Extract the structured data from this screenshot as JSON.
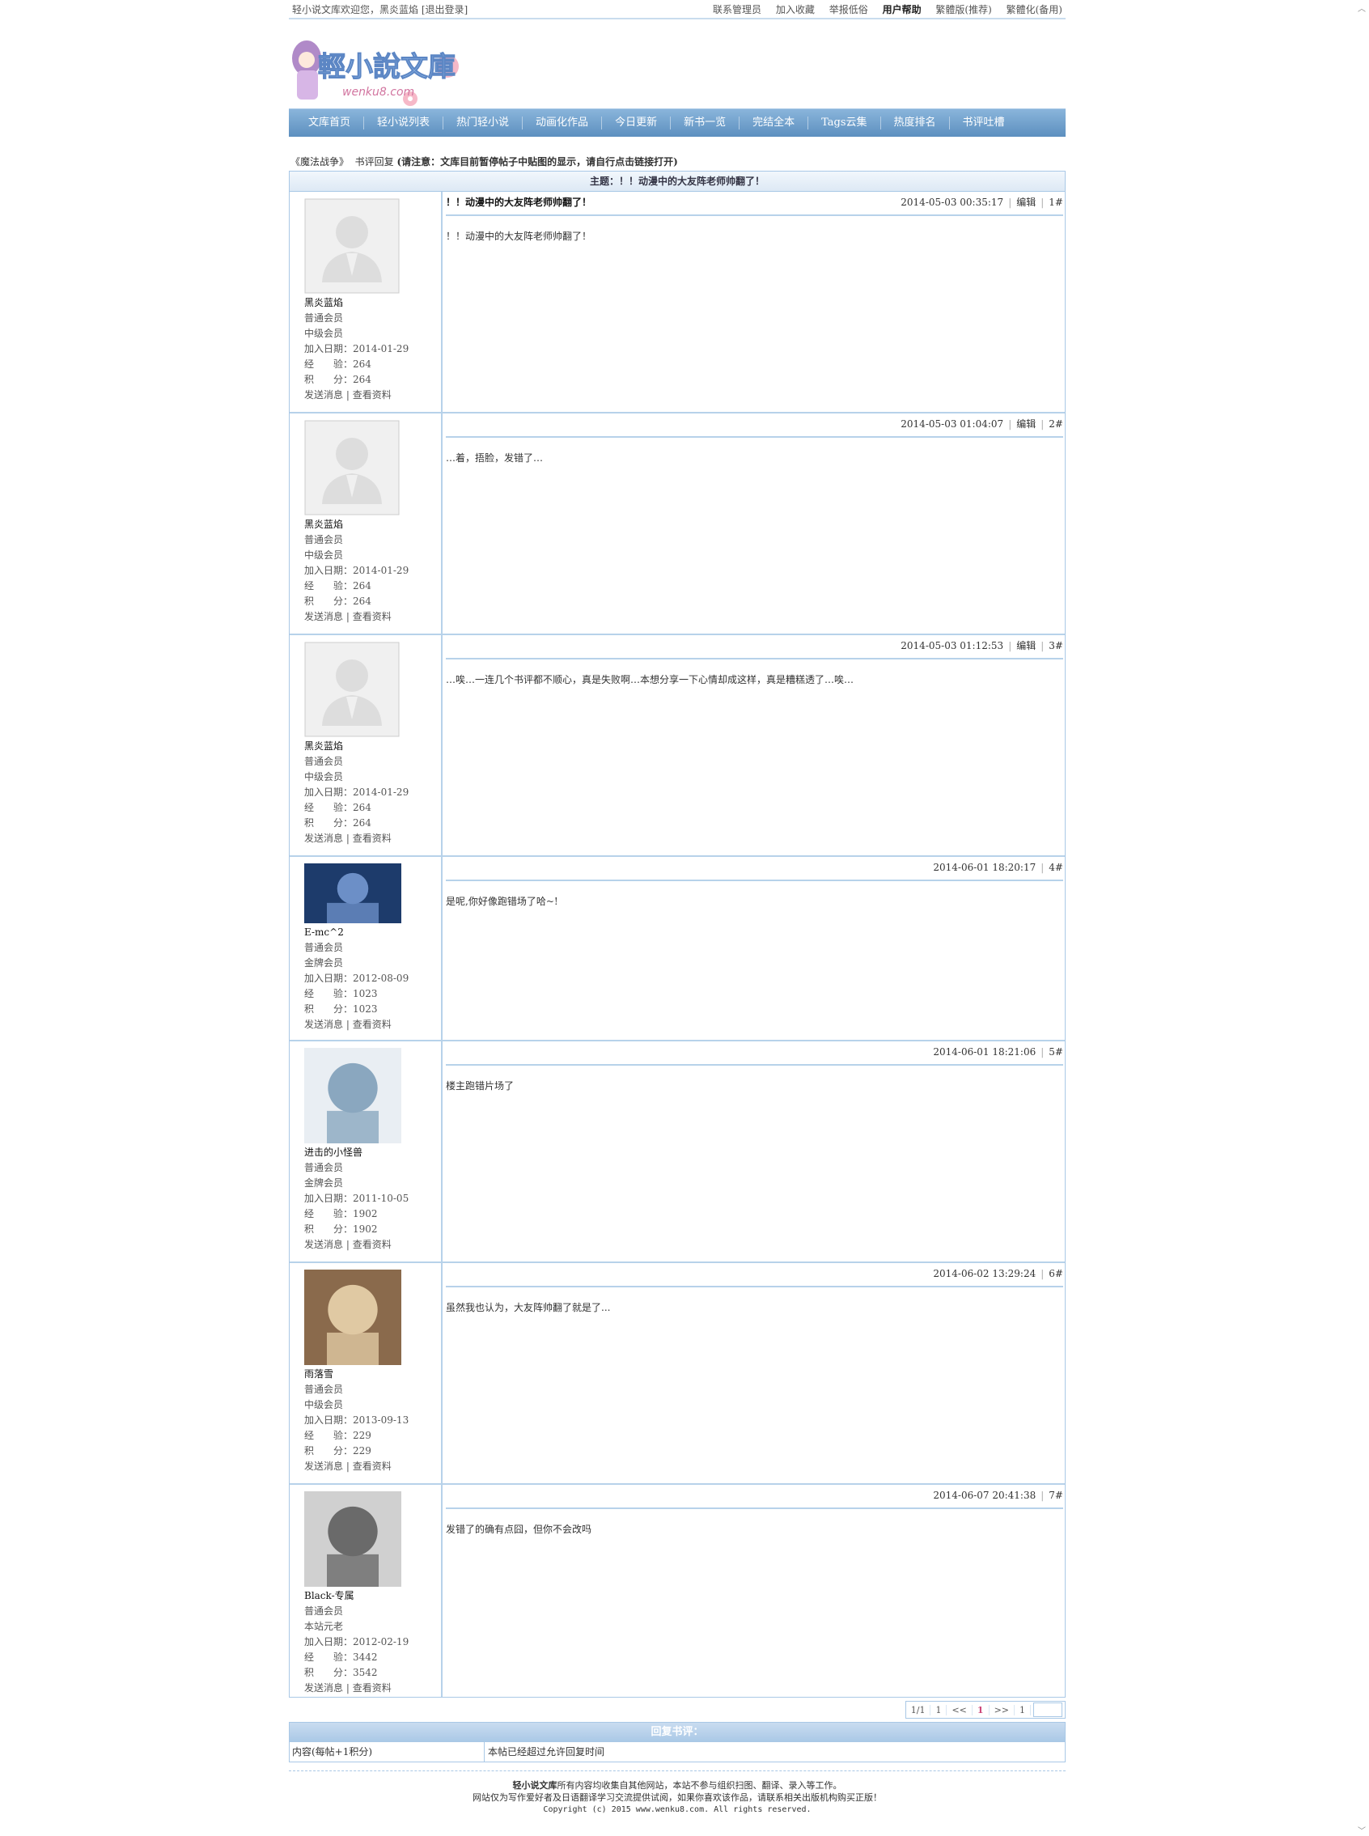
{
  "topbar": {
    "welcome": "轻小说文库欢迎您，黑炎蓝焰 [退出登录]",
    "links": [
      "联系管理员",
      "加入收藏",
      "举报低俗",
      "用户帮助",
      "繁體版(推荐)",
      "繁體化(备用)"
    ]
  },
  "logo": {
    "title": "輕小說文庫",
    "sub": "wenku8.com"
  },
  "nav": [
    "文库首页",
    "轻小说列表",
    "热门轻小说",
    "动画化作品",
    "今日更新",
    "新书一览",
    "完结全本",
    "Tags云集",
    "热度排名",
    "书评吐槽"
  ],
  "crumb": {
    "book": "《魔法战争》",
    "section": "书评回复",
    "notice": "(请注意：文库目前暂停帖子中贴图的显示，请自行点击链接打开)"
  },
  "subject": "主题：！！动漫中的大友阵老师帅翻了！",
  "labels": {
    "join": "加入日期：",
    "exp": "经　　验：",
    "points": "积　　分：",
    "msg": "发送消息",
    "profile": "查看资料",
    "edit": "编辑"
  },
  "posts": [
    {
      "user": "黑炎蓝焰",
      "group": "普通会员",
      "rank": "中级会员",
      "join": "2014-01-29",
      "exp": "264",
      "points": "264",
      "title": "！！动漫中的大友阵老师帅翻了！",
      "time": "2014-05-03 00:35:17",
      "edit": true,
      "floor": "1#",
      "text": "！！动漫中的大友阵老师帅翻了！",
      "avatar": "default"
    },
    {
      "user": "黑炎蓝焰",
      "group": "普通会员",
      "rank": "中级会员",
      "join": "2014-01-29",
      "exp": "264",
      "points": "264",
      "title": "",
      "time": "2014-05-03 01:04:07",
      "edit": true,
      "floor": "2#",
      "text": "…着，捂脸，发错了…",
      "avatar": "default"
    },
    {
      "user": "黑炎蓝焰",
      "group": "普通会员",
      "rank": "中级会员",
      "join": "2014-01-29",
      "exp": "264",
      "points": "264",
      "title": "",
      "time": "2014-05-03 01:12:53",
      "edit": true,
      "floor": "3#",
      "text": "…唉…一连几个书评都不顺心，真是失败啊…本想分享一下心情却成这样，真是糟糕透了…唉…",
      "avatar": "default"
    },
    {
      "user": "E-mc^2",
      "group": "普通会员",
      "rank": "金牌会员",
      "join": "2012-08-09",
      "exp": "1023",
      "points": "1023",
      "title": "",
      "time": "2014-06-01 18:20:17",
      "edit": false,
      "floor": "4#",
      "text": "是呢,你好像跑错场了哈~!",
      "avatar": "anime1"
    },
    {
      "user": "进击的小怪兽",
      "group": "普通会员",
      "rank": "金牌会员",
      "join": "2011-10-05",
      "exp": "1902",
      "points": "1902",
      "title": "",
      "time": "2014-06-01 18:21:06",
      "edit": false,
      "floor": "5#",
      "text": "楼主跑错片场了",
      "avatar": "anime2"
    },
    {
      "user": "雨落雪",
      "group": "普通会员",
      "rank": "中级会员",
      "join": "2013-09-13",
      "exp": "229",
      "points": "229",
      "title": "",
      "time": "2014-06-02 13:29:24",
      "edit": false,
      "floor": "6#",
      "text": "虽然我也认为，大友阵帅翻了就是了...",
      "avatar": "anime3"
    },
    {
      "user": "Black-专属",
      "group": "普通会员",
      "rank": "本站元老",
      "join": "2012-02-19",
      "exp": "3442",
      "points": "3542",
      "title": "",
      "time": "2014-06-07 20:41:38",
      "edit": false,
      "floor": "7#",
      "text": "发错了的确有点囧，但你不会改吗",
      "avatar": "anime4"
    }
  ],
  "pager": [
    "1/1",
    "1",
    "<<",
    "1",
    ">>",
    "1"
  ],
  "reply": {
    "title": "回复书评：",
    "label": "内容(每帖+1积分)",
    "note": "本帖已经超过允许回复时间"
  },
  "footer": {
    "brand": "轻小说文库",
    "line1": "所有内容均收集自其他网站，本站不参与组织扫图、翻译、录入等工作。",
    "line2": "网站仅为写作爱好者及日语翻译学习交流提供试阅，如果你喜欢该作品，请联系相关出版机构购买正版！",
    "line3": "Copyright (c) 2015 www.wenku8.com. All rights reserved."
  }
}
